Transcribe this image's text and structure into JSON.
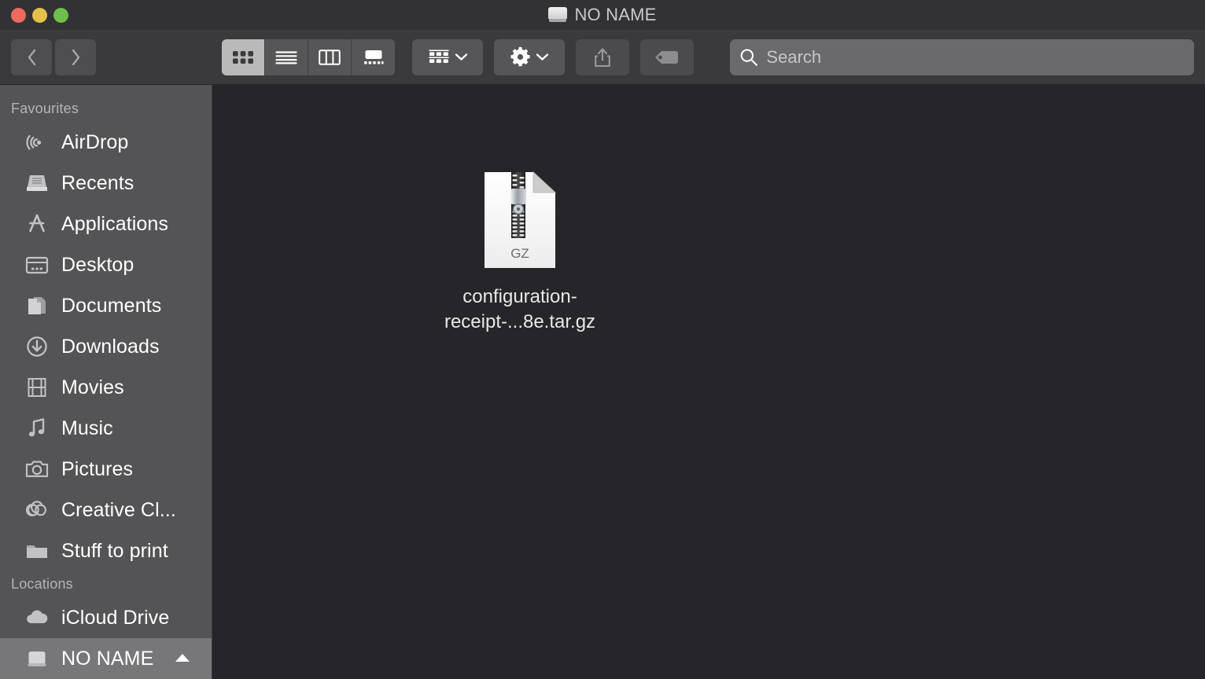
{
  "window": {
    "title": "NO NAME",
    "title_icon": "hard-drive-icon",
    "traffic_lights": [
      {
        "name": "close-button",
        "color": "#ec6a5e"
      },
      {
        "name": "minimize-button",
        "color": "#e5c04b"
      },
      {
        "name": "maximize-button",
        "color": "#6ec04a"
      }
    ]
  },
  "toolbar": {
    "back_label": "Back",
    "forward_label": "Forward",
    "view_modes": [
      {
        "name": "icon-view",
        "label": "Icon View",
        "active": true
      },
      {
        "name": "list-view",
        "label": "List View",
        "active": false
      },
      {
        "name": "column-view",
        "label": "Column View",
        "active": false
      },
      {
        "name": "gallery-view",
        "label": "Gallery View",
        "active": false
      }
    ],
    "group_label": "Group Items",
    "action_label": "Action",
    "share_label": "Share",
    "tags_label": "Edit Tags"
  },
  "search": {
    "placeholder": "Search",
    "value": ""
  },
  "sidebar": {
    "sections": [
      {
        "header": "Favourites",
        "items": [
          {
            "label": "AirDrop",
            "icon": "airdrop-icon",
            "selected": false
          },
          {
            "label": "Recents",
            "icon": "recents-icon",
            "selected": false
          },
          {
            "label": "Applications",
            "icon": "applications-icon",
            "selected": false
          },
          {
            "label": "Desktop",
            "icon": "desktop-icon",
            "selected": false
          },
          {
            "label": "Documents",
            "icon": "documents-icon",
            "selected": false
          },
          {
            "label": "Downloads",
            "icon": "downloads-icon",
            "selected": false
          },
          {
            "label": "Movies",
            "icon": "movies-icon",
            "selected": false
          },
          {
            "label": "Music",
            "icon": "music-icon",
            "selected": false
          },
          {
            "label": "Pictures",
            "icon": "pictures-icon",
            "selected": false
          },
          {
            "label": "Creative Cl...",
            "icon": "creative-cloud-icon",
            "selected": false
          },
          {
            "label": "Stuff to print",
            "icon": "folder-icon",
            "selected": false
          }
        ]
      },
      {
        "header": "Locations",
        "items": [
          {
            "label": "iCloud Drive",
            "icon": "icloud-icon",
            "selected": false
          },
          {
            "label": "NO NAME",
            "icon": "external-drive-icon",
            "selected": true,
            "eject": true
          }
        ]
      }
    ]
  },
  "content": {
    "files": [
      {
        "name": "configuration-receipt-...8e.tar.gz",
        "kind_label": "GZ",
        "icon": "gzip-archive-icon"
      }
    ]
  },
  "colors": {
    "titlebar": "#323234",
    "toolbar": "#3a3a3c",
    "sidebar": "#545456",
    "content": "#26262a",
    "selection": "#77777a",
    "search_field": "#6a6a6c"
  }
}
